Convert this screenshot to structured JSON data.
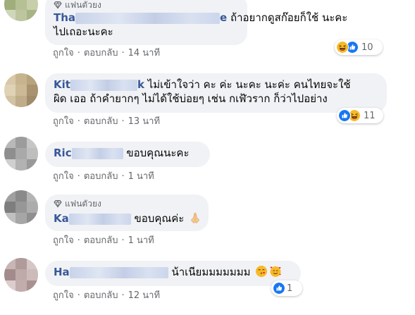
{
  "comments": [
    {
      "badge": "แฟนตัวยง",
      "name_start": "Tha",
      "name_end": "e",
      "lines": [
        "ถ้าอยากดูสก๊อยก็ใช้ นะคะ",
        "ไปเถอะนะคะ"
      ],
      "like": "ถูกใจ",
      "reply": "ตอบกลับ",
      "time": "14 นาที",
      "reaction_count": "10",
      "reaction_icons": [
        "haha-icon",
        "like-icon"
      ]
    },
    {
      "name_start": "Kit",
      "name_end": "k",
      "lines": [
        "ไม่เข้าใจว่า คะ ค่ะ นะคะ นะค่ะ คนไทยจะใช้",
        "ผิด เออ ถ้าคำยากๆ ไม่ได้ใช้บ่อยๆ เช่น กเฬ้วราก ก็ว่าไปอย่าง"
      ],
      "like": "ถูกใจ",
      "reply": "ตอบกลับ",
      "time": "13 นาที",
      "reaction_count": "11",
      "reaction_icons": [
        "like-icon",
        "haha-icon"
      ]
    },
    {
      "name_start": "Ric",
      "text": "ขอบคุณนะคะ",
      "like": "ถูกใจ",
      "reply": "ตอบกลับ",
      "time": "1 นาที"
    },
    {
      "badge": "แฟนตัวยง",
      "name_start": "Ka",
      "text": "ขอบคุณค่ะ",
      "emoji": "pray-icon",
      "like": "ถูกใจ",
      "reply": "ตอบกลับ",
      "time": "1 นาที"
    },
    {
      "name_start": "Ha",
      "text": "น้าเนียมมมมมมม",
      "emojis": [
        "kiss-face-icon",
        "hearts-face-icon"
      ],
      "like": "ถูกใจ",
      "reply": "ตอบกลับ",
      "time": "12 นาที",
      "reaction_count": "1",
      "reaction_icons": [
        "like-icon"
      ]
    }
  ],
  "colors": {
    "bubble": "#f0f2f5",
    "name": "#385898",
    "meta": "#65676b",
    "like_blue": "#1877f2",
    "haha_yellow": "#f7b928"
  }
}
